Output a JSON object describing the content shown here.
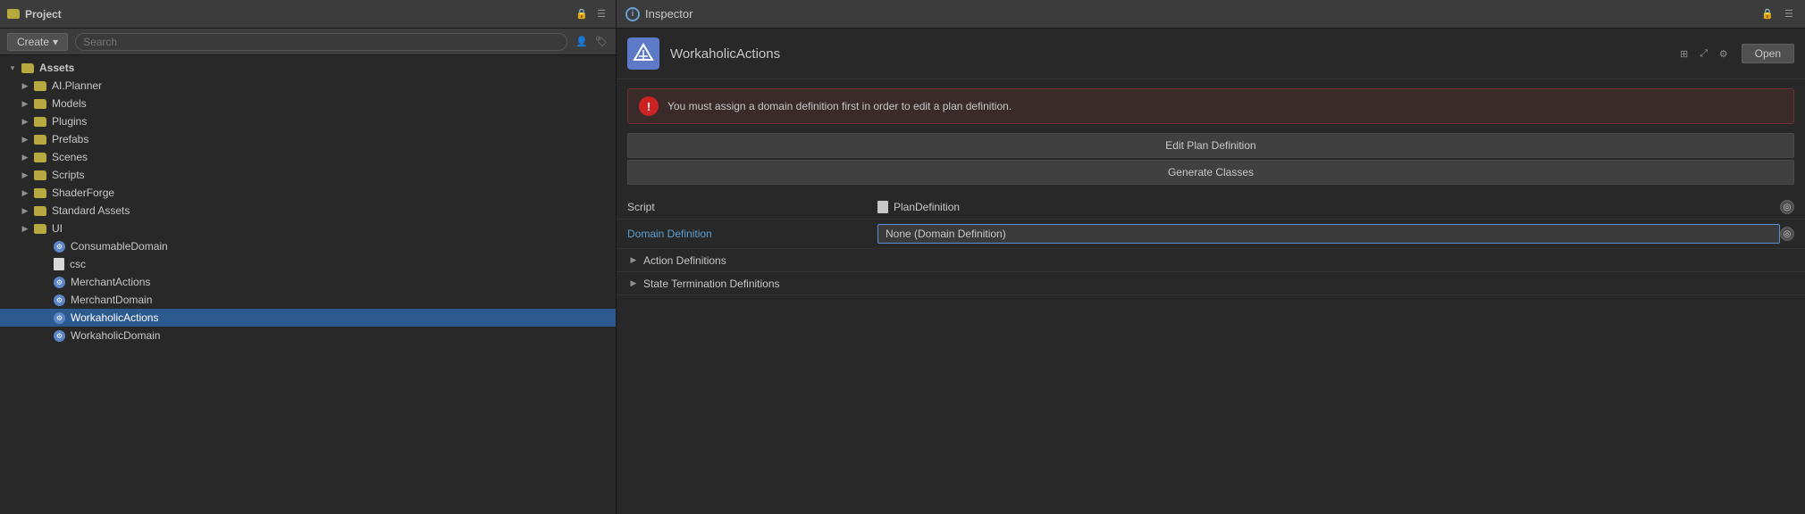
{
  "leftPanel": {
    "title": "Project",
    "createButton": "Create",
    "searchPlaceholder": "Search",
    "tree": [
      {
        "id": "assets",
        "label": "Assets",
        "type": "folder-root",
        "indent": 0,
        "expanded": true,
        "hasChevron": true
      },
      {
        "id": "ai-planner",
        "label": "AI.Planner",
        "type": "folder",
        "indent": 1,
        "hasChevron": true
      },
      {
        "id": "models",
        "label": "Models",
        "type": "folder",
        "indent": 1,
        "hasChevron": true
      },
      {
        "id": "plugins",
        "label": "Plugins",
        "type": "folder",
        "indent": 1,
        "hasChevron": true
      },
      {
        "id": "prefabs",
        "label": "Prefabs",
        "type": "folder",
        "indent": 1,
        "hasChevron": true
      },
      {
        "id": "scenes",
        "label": "Scenes",
        "type": "folder",
        "indent": 1,
        "hasChevron": true
      },
      {
        "id": "scripts",
        "label": "Scripts",
        "type": "folder",
        "indent": 1,
        "hasChevron": true
      },
      {
        "id": "shader-forge",
        "label": "ShaderForge",
        "type": "folder",
        "indent": 1,
        "hasChevron": true
      },
      {
        "id": "standard-assets",
        "label": "Standard Assets",
        "type": "folder",
        "indent": 1,
        "hasChevron": true
      },
      {
        "id": "ui",
        "label": "UI",
        "type": "folder",
        "indent": 1,
        "hasChevron": true
      },
      {
        "id": "consumable-domain",
        "label": "ConsumableDomain",
        "type": "file-gear",
        "indent": 2,
        "hasChevron": false
      },
      {
        "id": "csc",
        "label": "csc",
        "type": "file-white",
        "indent": 2,
        "hasChevron": false
      },
      {
        "id": "merchant-actions",
        "label": "MerchantActions",
        "type": "file-gear",
        "indent": 2,
        "hasChevron": false
      },
      {
        "id": "merchant-domain",
        "label": "MerchantDomain",
        "type": "file-gear",
        "indent": 2,
        "hasChevron": false
      },
      {
        "id": "workaholic-actions",
        "label": "WorkaholicActions",
        "type": "file-gear",
        "indent": 2,
        "hasChevron": false,
        "selected": true
      },
      {
        "id": "workaholic-domain",
        "label": "WorkaholicDomain",
        "type": "file-gear",
        "indent": 2,
        "hasChevron": false
      }
    ]
  },
  "rightPanel": {
    "inspectorLabel": "Inspector",
    "assetName": "WorkaholicActions",
    "openButton": "Open",
    "warningMessage": "You must assign a domain definition first in order to edit a plan definition.",
    "editPlanDefinitionButton": "Edit Plan Definition",
    "generateClassesButton": "Generate Classes",
    "properties": {
      "scriptLabel": "Script",
      "scriptValue": "PlanDefinition",
      "domainDefinitionLabel": "Domain Definition",
      "domainDefinitionValue": "None (Domain Definition)"
    },
    "foldouts": [
      {
        "label": "Action Definitions"
      },
      {
        "label": "State Termination Definitions"
      }
    ]
  }
}
